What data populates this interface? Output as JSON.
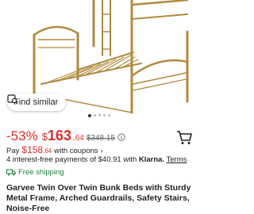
{
  "hero": {
    "image_name": "bunk-bed-product-photo",
    "find_similar_label": "Find similar",
    "carousel_dots": 5,
    "active_dot": 0
  },
  "price": {
    "discount": "-53%",
    "currency": "$",
    "main": "163",
    "cents": ".64",
    "original": "$348.15"
  },
  "pay": {
    "prefix": "Pay",
    "currency": "$",
    "amount": "158",
    "cents": ".64",
    "suffix": "with coupons",
    "chevron": "›"
  },
  "installments": {
    "text": "4 interest-free payments of $40.91 with",
    "provider": "Klarna.",
    "terms": "Terms"
  },
  "shipping": {
    "label": "Free shipping",
    "color": "#1a7f3c"
  },
  "product": {
    "title": "Garvee Twin Over Twin Bunk Beds with Sturdy Metal Frame, Arched Guardrails, Safety Stairs, Noise-Free"
  },
  "colors": {
    "accent_red": "#e02d2d",
    "bed_gold": "#b08a3e"
  }
}
